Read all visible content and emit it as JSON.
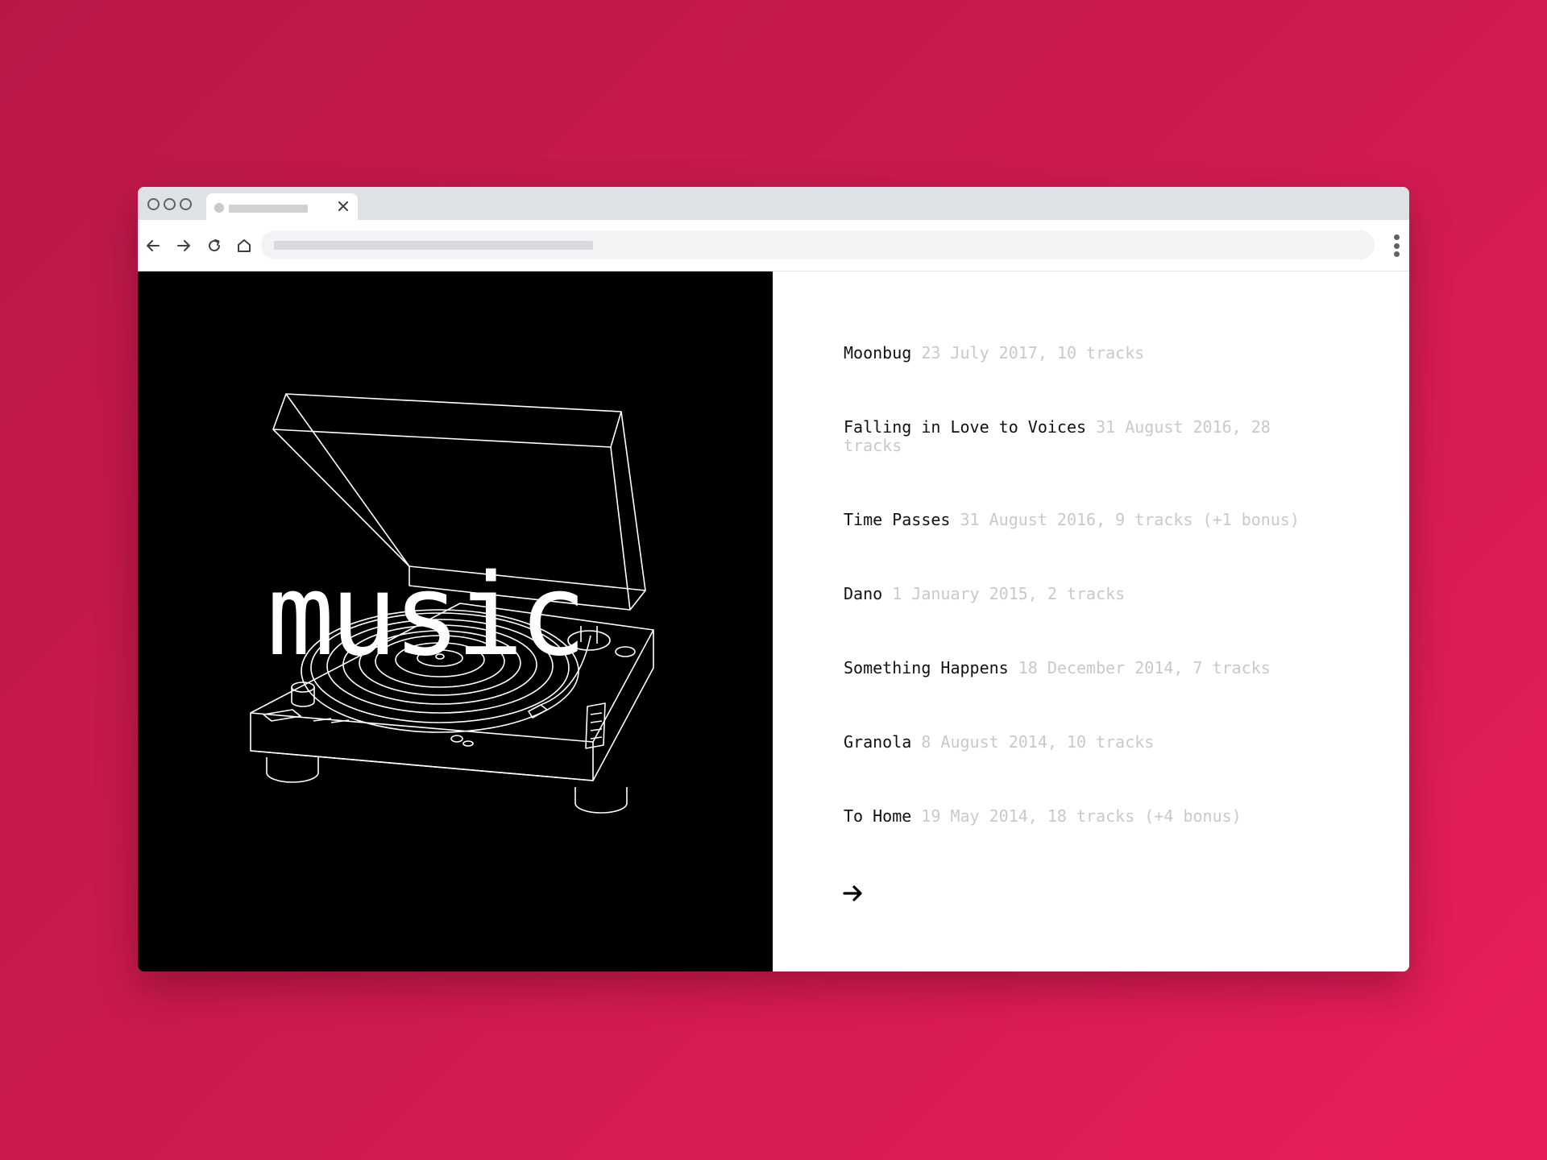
{
  "browser": {
    "tab_close_icon": "close-icon",
    "nav_icons": [
      "back-arrow-icon",
      "forward-arrow-icon",
      "reload-icon",
      "home-icon"
    ],
    "menu_icon": "kebab-menu-icon"
  },
  "hero": {
    "title": "music",
    "illustration": "turntable-illustration",
    "background_color": "#000000",
    "text_color": "#ffffff"
  },
  "albums": [
    {
      "name": "Moonbug",
      "meta": "23 July 2017, 10 tracks"
    },
    {
      "name": "Falling in Love to Voices",
      "meta": "31 August 2016, 28 tracks"
    },
    {
      "name": "Time Passes",
      "meta": "31 August 2016, 9 tracks (+1 bonus)"
    },
    {
      "name": "Dano",
      "meta": "1 January 2015, 2 tracks"
    },
    {
      "name": "Something Happens",
      "meta": "18 December 2014, 7 tracks"
    },
    {
      "name": "Granola",
      "meta": "8 August 2014, 10 tracks"
    },
    {
      "name": "To Home",
      "meta": "19 May 2014, 18 tracks (+4 bonus)"
    }
  ],
  "next_icon": "right-arrow-icon",
  "colors": {
    "background_start": "#b91847",
    "background_end": "#e81e5a",
    "meta_text": "#c9c9c9"
  }
}
